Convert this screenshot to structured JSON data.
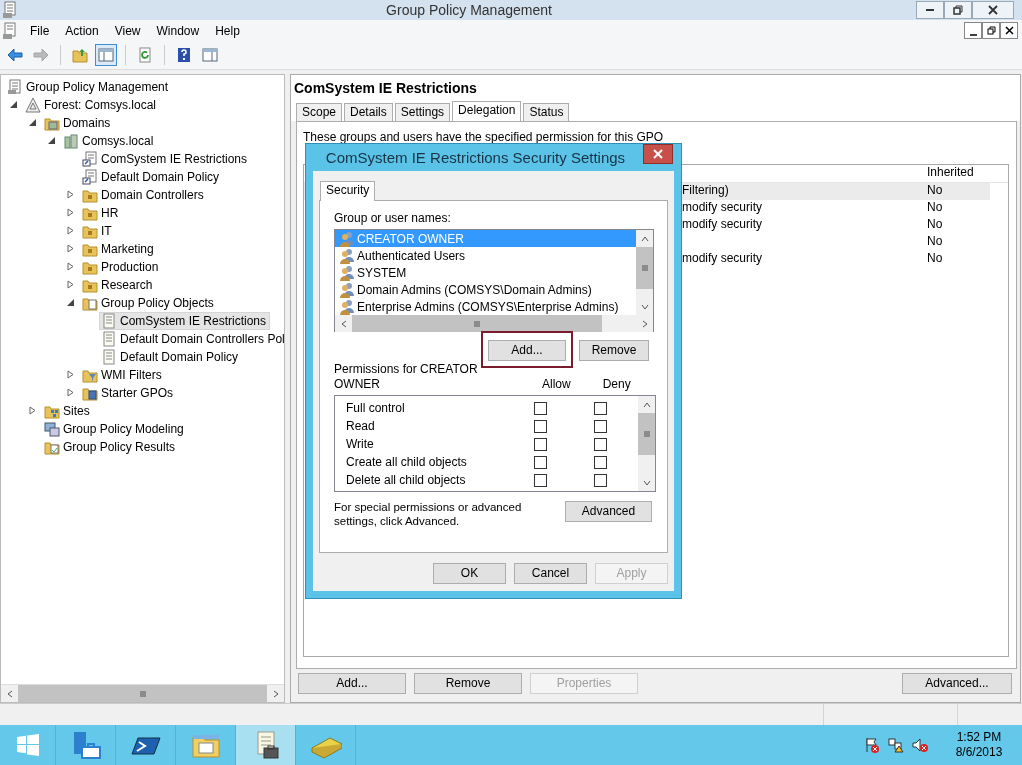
{
  "window": {
    "title": "Group Policy Management"
  },
  "menu": [
    "File",
    "Action",
    "View",
    "Window",
    "Help"
  ],
  "toolbar": [
    {
      "kind": "back",
      "disabled": false,
      "pressed": false
    },
    {
      "kind": "forward",
      "disabled": true,
      "pressed": false
    },
    {
      "kind": "up",
      "disabled": false,
      "pressed": false
    },
    {
      "kind": "tree",
      "disabled": false,
      "pressed": true
    },
    {
      "kind": "refresh",
      "disabled": false,
      "pressed": false
    },
    {
      "kind": "help",
      "disabled": false,
      "pressed": false
    },
    {
      "kind": "actions",
      "disabled": false,
      "pressed": false
    }
  ],
  "tree": [
    {
      "label": "Group Policy Management",
      "kind": "console",
      "selected": false,
      "children": [
        {
          "label": "Forest: Comsys.local",
          "kind": "forest",
          "expanded": true,
          "selected": false,
          "children": [
            {
              "label": "Domains",
              "kind": "domains",
              "expanded": true,
              "selected": false,
              "children": [
                {
                  "label": "Comsys.local",
                  "kind": "domain",
                  "expanded": true,
                  "selected": false,
                  "children": [
                    {
                      "label": "ComSystem IE Restrictions",
                      "kind": "link",
                      "selected": false
                    },
                    {
                      "label": "Default Domain Policy",
                      "kind": "link",
                      "selected": false
                    },
                    {
                      "label": "Domain Controllers",
                      "kind": "ou",
                      "expanded": false,
                      "selected": false
                    },
                    {
                      "label": "HR",
                      "kind": "ou",
                      "expanded": false,
                      "selected": false
                    },
                    {
                      "label": "IT",
                      "kind": "ou",
                      "expanded": false,
                      "selected": false
                    },
                    {
                      "label": "Marketing",
                      "kind": "ou",
                      "expanded": false,
                      "selected": false
                    },
                    {
                      "label": "Production",
                      "kind": "ou",
                      "expanded": false,
                      "selected": false
                    },
                    {
                      "label": "Research",
                      "kind": "ou",
                      "expanded": false,
                      "selected": false
                    },
                    {
                      "label": "Group Policy Objects",
                      "kind": "gpofolder",
                      "expanded": true,
                      "selected": false,
                      "children": [
                        {
                          "label": "ComSystem IE Restrictions",
                          "kind": "gpo",
                          "selected": true
                        },
                        {
                          "label": "Default Domain Controllers Pol",
                          "kind": "gpo",
                          "selected": false
                        },
                        {
                          "label": "Default Domain Policy",
                          "kind": "gpo",
                          "selected": false
                        }
                      ]
                    },
                    {
                      "label": "WMI Filters",
                      "kind": "wmi",
                      "expanded": false,
                      "selected": false
                    },
                    {
                      "label": "Starter GPOs",
                      "kind": "starter",
                      "expanded": false,
                      "selected": false
                    }
                  ]
                }
              ]
            },
            {
              "label": "Sites",
              "kind": "sites",
              "expanded": false,
              "selected": false
            },
            {
              "label": "Group Policy Modeling",
              "kind": "modeling",
              "selected": false
            },
            {
              "label": "Group Policy Results",
              "kind": "results",
              "selected": false
            }
          ]
        }
      ]
    }
  ],
  "details": {
    "title": "ComSystem IE Restrictions",
    "tabs": [
      {
        "label": "Scope",
        "selected": false
      },
      {
        "label": "Details",
        "selected": false
      },
      {
        "label": "Settings",
        "selected": false
      },
      {
        "label": "Delegation",
        "selected": true
      },
      {
        "label": "Status",
        "selected": false
      }
    ],
    "description": "These groups and users have the specified permission for this GPO",
    "table": {
      "inherited_header": "Inherited",
      "rows": [
        {
          "column_1": "Filtering)",
          "inherited": "No",
          "selected": true
        },
        {
          "column_1": "modify security",
          "inherited": "No",
          "selected": false
        },
        {
          "column_1": "modify security",
          "inherited": "No",
          "selected": false
        },
        {
          "inherited": "No",
          "selected": false
        },
        {
          "column_1": "modify security",
          "inherited": "No",
          "selected": false
        }
      ]
    },
    "buttons": [
      {
        "label": "Add...",
        "disabled": false
      },
      {
        "label": "Remove",
        "disabled": false
      },
      {
        "label": "Properties",
        "disabled": true
      },
      {
        "label": "Advanced...",
        "disabled": false
      }
    ]
  },
  "dialog": {
    "title": "ComSystem IE Restrictions Security Settings",
    "tabs": [
      {
        "label": "Security",
        "selected": true
      }
    ],
    "group_label": "Group or user names:",
    "users": [
      {
        "name": "CREATOR OWNER",
        "selected": true
      },
      {
        "name": "Authenticated Users",
        "selected": false
      },
      {
        "name": "SYSTEM",
        "selected": false
      },
      {
        "name": "Domain Admins (COMSYS\\Domain Admins)",
        "selected": false
      },
      {
        "name": "Enterprise Admins (COMSYS\\Enterprise Admins)",
        "selected": false
      }
    ],
    "user_buttons": [
      {
        "label": "Add...",
        "highlighted": true
      },
      {
        "label": "Remove",
        "highlighted": false
      }
    ],
    "permissions_label": "Permissions for CREATOR OWNER",
    "allow_header": "Allow",
    "deny_header": "Deny",
    "permissions": [
      {
        "name": "Full control",
        "allow": false,
        "deny": false
      },
      {
        "name": "Read",
        "allow": false,
        "deny": false
      },
      {
        "name": "Write",
        "allow": false,
        "deny": false
      },
      {
        "name": "Create all child objects",
        "allow": false,
        "deny": false
      },
      {
        "name": "Delete all child objects",
        "allow": false,
        "deny": false
      }
    ],
    "advanced_note": "For special permissions or advanced settings, click Advanced.",
    "advanced_button": "Advanced",
    "footer_buttons": [
      {
        "label": "OK",
        "disabled": false
      },
      {
        "label": "Cancel",
        "disabled": false
      },
      {
        "label": "Apply",
        "disabled": true
      }
    ]
  },
  "taskbar": {
    "apps": [
      {
        "kind": "server",
        "selected": false
      },
      {
        "kind": "powershell",
        "selected": false
      },
      {
        "kind": "explorer",
        "selected": false
      },
      {
        "kind": "gpm",
        "selected": true
      },
      {
        "kind": "book",
        "selected": false
      }
    ],
    "clock": {
      "time": "1:52 PM",
      "date": "8/6/2013"
    }
  }
}
